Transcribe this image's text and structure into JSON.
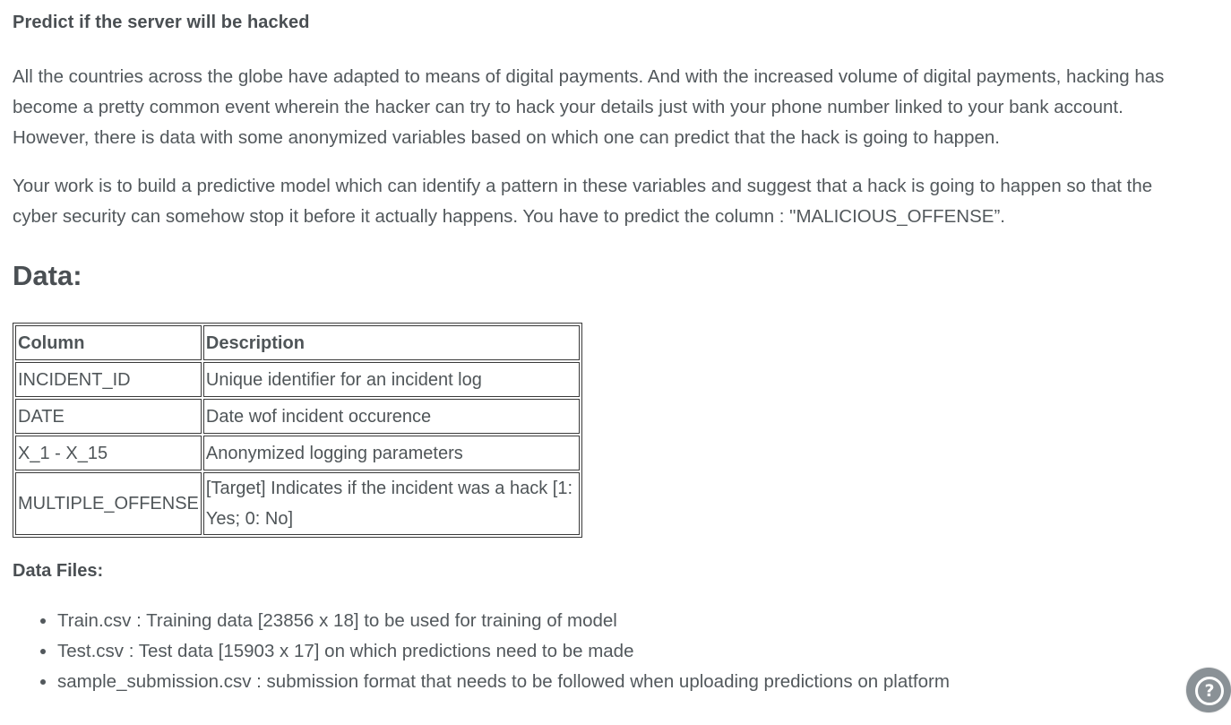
{
  "title": "Predict if the server will be hacked",
  "paragraphs": [
    "All the countries across the globe have adapted to means of digital payments. And with the increased volume of digital payments, hacking has become a pretty common event wherein the hacker can try to hack your details just with your phone number linked to your bank account. However, there is data with some anonymized variables based on which one can predict that the hack is going to happen.",
    "Your work is to build a predictive model which can identify a pattern in these variables and suggest that a hack is going to happen so that the cyber security can somehow stop it before it actually happens. You have to predict the column : \"MALICIOUS_OFFENSE”."
  ],
  "data_heading": "Data:",
  "table": {
    "headers": [
      "Column",
      "Description"
    ],
    "rows": [
      [
        "INCIDENT_ID",
        "Unique identifier for an incident log"
      ],
      [
        "DATE",
        "Date wof incident occurence"
      ],
      [
        "X_1 - X_15",
        "Anonymized logging parameters"
      ],
      [
        "MULTIPLE_OFFENSE",
        "[Target] Indicates if the incident was a hack [1: Yes; 0: No]"
      ]
    ]
  },
  "files_heading": "Data Files:",
  "files": [
    "Train.csv : Training data [23856 x 18] to be used for training of model",
    "Test.csv : Test data [15903 x 17] on which predictions need to be made",
    "sample_submission.csv : submission format that needs to be followed when uploading predictions on platform"
  ],
  "help_icon": "question-circle-icon",
  "help_glyph": "?",
  "colors": {
    "text": "#52585c",
    "heading": "#4a4f53",
    "help_button_bg": "#8a9196"
  }
}
